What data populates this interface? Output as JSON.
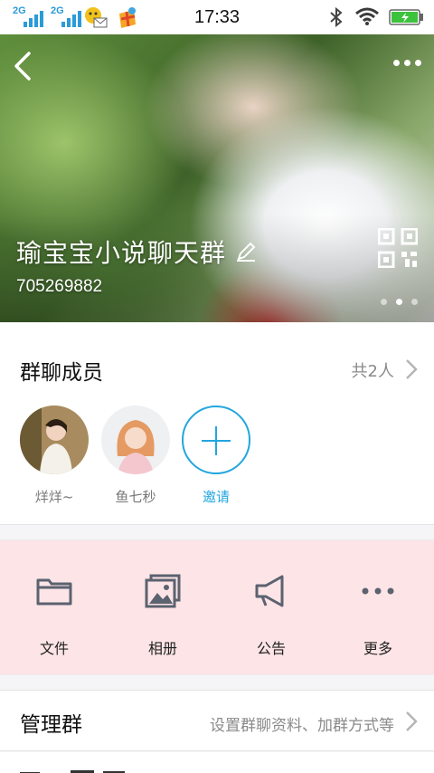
{
  "status_bar": {
    "time": "17:33",
    "signal1_label": "2G",
    "signal2_label": "2G",
    "icons": [
      "signal-icon",
      "signal-icon",
      "mail-notification-icon",
      "gift-app-icon",
      "bluetooth-icon",
      "wifi-icon",
      "battery-charging-icon"
    ],
    "colors": {
      "signal": "#2a9bd8",
      "battery": "#3cc23c"
    }
  },
  "header": {
    "back_icon": "chevron-left-icon",
    "more_icon": "more-dots-icon",
    "group_name": "瑜宝宝小说聊天群",
    "edit_icon": "pencil-icon",
    "group_id": "705269882",
    "qr_icon": "qr-code-icon",
    "carousel_pages": 3,
    "carousel_active": 2
  },
  "members": {
    "title": "群聊成员",
    "count": "共2人",
    "items": [
      {
        "name": "烊烊~"
      },
      {
        "name": "鱼七秒"
      }
    ],
    "invite_label": "邀请",
    "accent": "#22a6e0"
  },
  "tools": {
    "background": "#fde4e6",
    "items": [
      {
        "label": "文件",
        "icon": "folder-icon"
      },
      {
        "label": "相册",
        "icon": "album-icon"
      },
      {
        "label": "公告",
        "icon": "megaphone-icon"
      },
      {
        "label": "更多",
        "icon": "more-dots-icon"
      }
    ]
  },
  "manage": {
    "title": "管理群",
    "hint": "设置群聊资料、加群方式等"
  }
}
